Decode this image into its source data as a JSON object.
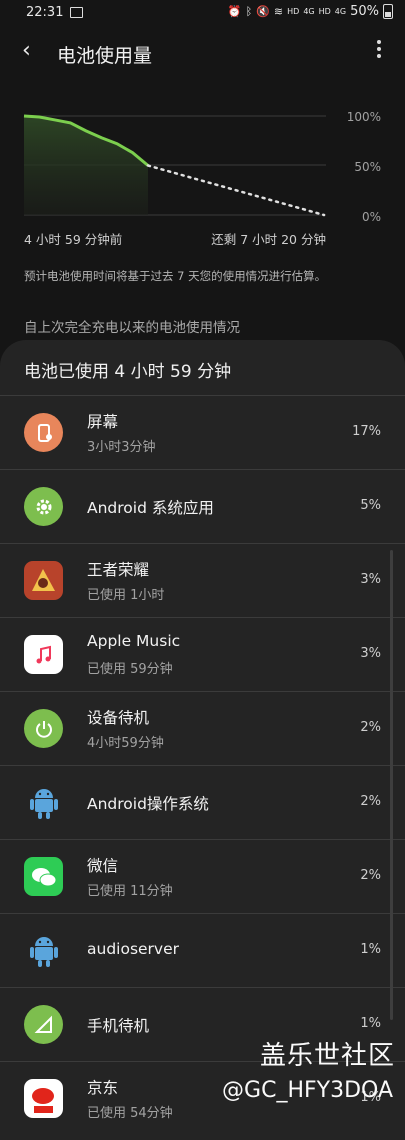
{
  "status_bar": {
    "time": "22:31",
    "hd1": "HD",
    "net1": "4G",
    "hd2": "HD",
    "net2": "4G",
    "battery": "50%"
  },
  "header": {
    "title": "电池使用量"
  },
  "chart": {
    "y_labels": [
      "100%",
      "50%",
      "0%"
    ],
    "start_label": "4 小时 59 分钟前",
    "end_label": "还剩 7 小时 20 分钟"
  },
  "chart_data": {
    "type": "area",
    "y_ticks": [
      "100%",
      "50%",
      "0%"
    ],
    "ylim": [
      0,
      100
    ],
    "series": [
      {
        "values": [
          100,
          99,
          96,
          93,
          85,
          78,
          72,
          63,
          50
        ]
      },
      {
        "values": [
          50,
          0
        ]
      }
    ]
  },
  "note": "预计电池使用时间将基于过去 7 天您的使用情况进行估算。",
  "section_header": "自上次完全充电以来的电池使用情况",
  "usage": {
    "title": "电池已使用 4 小时 59 分钟",
    "apps": [
      {
        "name": "屏幕",
        "sub": "3小时3分钟",
        "pct": "17%",
        "icon": "screen-icon",
        "color": "#e8865b"
      },
      {
        "name": "Android 系统应用",
        "sub": "",
        "pct": "5%",
        "icon": "gear-icon",
        "color": "#7dbe4e"
      },
      {
        "name": "王者荣耀",
        "sub": "已使用 1小时",
        "pct": "3%",
        "icon": "game-icon",
        "color": "#c4442b"
      },
      {
        "name": "Apple Music",
        "sub": "已使用 59分钟",
        "pct": "3%",
        "icon": "music-note-icon",
        "color": "#ffffff"
      },
      {
        "name": "设备待机",
        "sub": "4小时59分钟",
        "pct": "2%",
        "icon": "power-icon",
        "color": "#7dbe4e"
      },
      {
        "name": "Android操作系统",
        "sub": "",
        "pct": "2%",
        "icon": "android-icon",
        "color": "#5aa5dc"
      },
      {
        "name": "微信",
        "sub": "已使用 11分钟",
        "pct": "2%",
        "icon": "wechat-icon",
        "color": "#2ecc55"
      },
      {
        "name": "audioserver",
        "sub": "",
        "pct": "1%",
        "icon": "android-icon",
        "color": "#5aa5dc"
      },
      {
        "name": "手机待机",
        "sub": "",
        "pct": "1%",
        "icon": "signal-icon",
        "color": "#7dbe4e"
      },
      {
        "name": "京东",
        "sub": "已使用 54分钟",
        "pct": "1%",
        "icon": "jd-icon",
        "color": "#ffffff"
      }
    ]
  },
  "watermark": {
    "line1": "盖乐世社区",
    "line2": "@GC_HFY3DOA"
  }
}
